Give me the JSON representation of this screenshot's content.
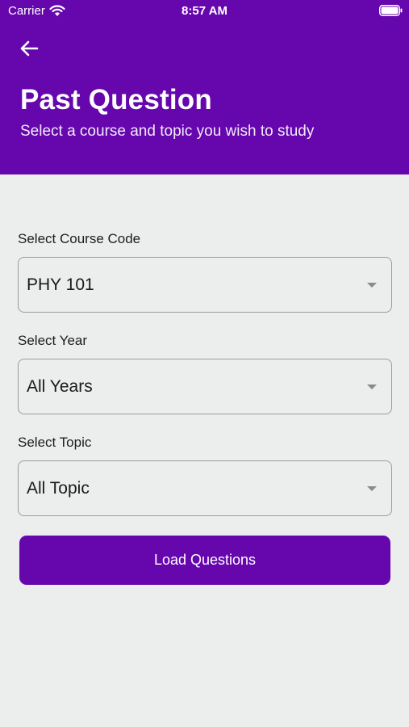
{
  "status_bar": {
    "carrier": "Carrier",
    "time": "8:57 AM"
  },
  "header": {
    "back_icon": "arrow-left-icon",
    "title": "Past Question",
    "subtitle": "Select a course and topic you wish to study",
    "background_color": "#6607AE"
  },
  "form": {
    "course": {
      "label": "Select Course Code",
      "value": "PHY 101"
    },
    "year": {
      "label": "Select Year",
      "value": "All Years"
    },
    "topic": {
      "label": "Select Topic",
      "value": "All Topic"
    }
  },
  "load_button": {
    "label": "Load Questions",
    "color": "#6607AE"
  }
}
